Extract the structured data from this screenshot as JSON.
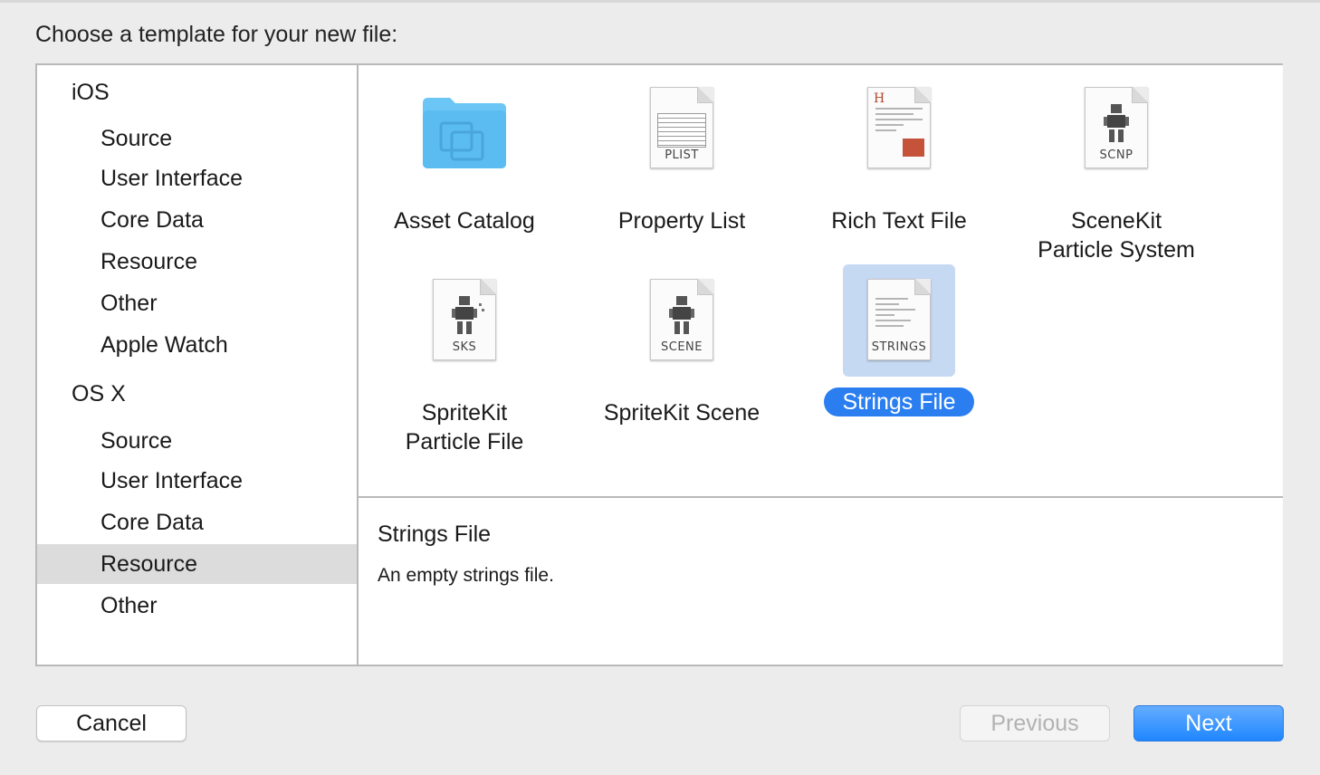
{
  "dialog": {
    "heading": "Choose a template for your new file:"
  },
  "sidebar": {
    "items": [
      {
        "label": "iOS",
        "kind": "group"
      },
      {
        "label": "Source",
        "kind": "child"
      },
      {
        "label": "User Interface",
        "kind": "child"
      },
      {
        "label": "Core Data",
        "kind": "child"
      },
      {
        "label": "Resource",
        "kind": "child"
      },
      {
        "label": "Other",
        "kind": "child"
      },
      {
        "label": "Apple Watch",
        "kind": "child"
      },
      {
        "label": "OS X",
        "kind": "group"
      },
      {
        "label": "Source",
        "kind": "child"
      },
      {
        "label": "User Interface",
        "kind": "child"
      },
      {
        "label": "Core Data",
        "kind": "child"
      },
      {
        "label": "Resource",
        "kind": "child",
        "selected": true
      },
      {
        "label": "Other",
        "kind": "child"
      }
    ]
  },
  "templates": [
    {
      "label": "Asset Catalog",
      "icon": "folder-icon",
      "tag": ""
    },
    {
      "label": "Property List",
      "icon": "plist-file-icon",
      "tag": "PLIST"
    },
    {
      "label": "Rich Text File",
      "icon": "rich-text-file-icon",
      "tag": ""
    },
    {
      "label": "SceneKit\nParticle System",
      "icon": "scnp-file-icon",
      "tag": "SCNP"
    },
    {
      "label": "SpriteKit\nParticle File",
      "icon": "sks-file-icon",
      "tag": "SKS"
    },
    {
      "label": "SpriteKit Scene",
      "icon": "scene-file-icon",
      "tag": "SCENE"
    },
    {
      "label": "Strings File",
      "icon": "strings-file-icon",
      "tag": "STRINGS",
      "selected": true
    }
  ],
  "description": {
    "title": "Strings File",
    "text": "An empty strings file."
  },
  "buttons": {
    "cancel": "Cancel",
    "previous": "Previous",
    "next": "Next"
  },
  "colors": {
    "selection_blue": "#2a7ef0",
    "selection_bg": "#c6d9f2",
    "folder_blue": "#5bbcf2"
  }
}
